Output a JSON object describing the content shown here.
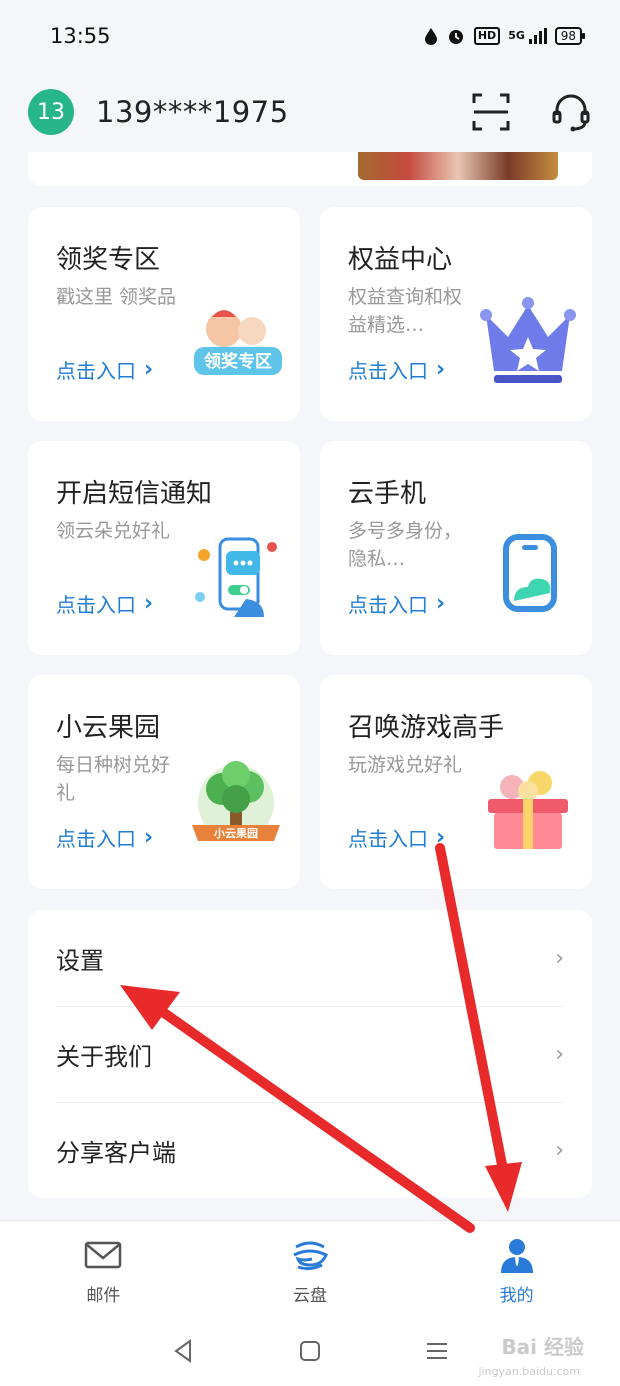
{
  "status_bar": {
    "time": "13:55",
    "network": "5G",
    "hd": "HD",
    "battery": "98"
  },
  "header": {
    "avatar_text": "13",
    "phone": "139****1975"
  },
  "cards": [
    {
      "title": "领奖专区",
      "desc": "戳这里 领奖品",
      "link": "点击入口"
    },
    {
      "title": "权益中心",
      "desc": "权益查询和权益精选…",
      "link": "点击入口"
    },
    {
      "title": "开启短信通知",
      "desc": "领云朵兑好礼",
      "link": "点击入口"
    },
    {
      "title": "云手机",
      "desc": "多号多身份，隐私…",
      "link": "点击入口"
    },
    {
      "title": "小云果园",
      "desc": "每日种树兑好礼",
      "link": "点击入口"
    },
    {
      "title": "召唤游戏高手",
      "desc": "玩游戏兑好礼",
      "link": "点击入口"
    }
  ],
  "menu": {
    "settings": "设置",
    "about": "关于我们",
    "share": "分享客户端",
    "arrow": "›"
  },
  "tabs": [
    {
      "label": "邮件",
      "icon": "mail-icon"
    },
    {
      "label": "云盘",
      "icon": "cloud-icon"
    },
    {
      "label": "我的",
      "icon": "profile-icon",
      "active": true
    }
  ],
  "illustration_text": {
    "prize_badge": "领奖专区",
    "orchard_badge": "小云果园"
  },
  "watermark": {
    "main": "Bai 经验",
    "sub": "jingyan.baidu.com"
  },
  "colors": {
    "accent": "#2a7bd8",
    "link": "#1f7ed3",
    "avatar": "#27b58a",
    "arrow_annotation": "#e82a2a"
  }
}
